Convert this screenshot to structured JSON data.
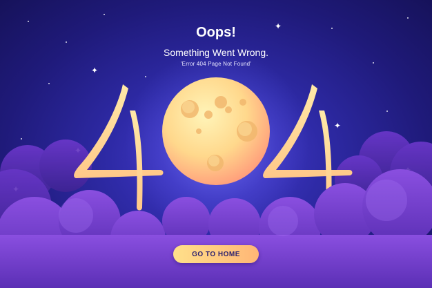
{
  "header": {
    "title": "Oops!",
    "subtitle": "Something Went Wrong.",
    "detail": "'Error 404 Page Not Found'"
  },
  "illustration": {
    "digit_left": "4",
    "digit_right": "4",
    "center": "moon-icon"
  },
  "actions": {
    "home_label": "GO TO HOME"
  },
  "colors": {
    "background": "#2e2aa6",
    "digits": "#ffd98a",
    "moon": "#ffd88c",
    "clouds": "#7a45d6",
    "button": "#ffc97e"
  }
}
